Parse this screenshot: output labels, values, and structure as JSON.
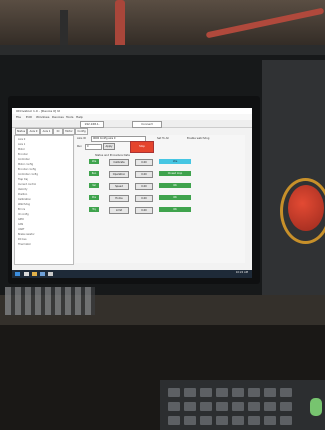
{
  "app": {
    "title": "ODrivetool 1.0 - [Device 0] UI"
  },
  "menu": [
    "File",
    "Edit",
    "Windows",
    "Devices",
    "Tools",
    "Help"
  ],
  "toolbar": {
    "address": "192.168.1.",
    "connect": "Connect"
  },
  "tabs": [
    "Status",
    "Axis 0",
    "Axis 1",
    "IO",
    "Motor",
    "Config"
  ],
  "tree": [
    "Axis 0",
    "Axis 1",
    "Motor",
    "Encoder",
    "Controller",
    "Motor config",
    "Encoder config",
    "Controller config",
    "Trap traj",
    "Current control",
    "Velocity",
    "Position",
    "Calibration",
    "Watchdog",
    "Errors",
    "IO config",
    "GPIO",
    "CAN",
    "UART",
    "Brake resistor",
    "DC bus",
    "Thermistor"
  ],
  "panel": {
    "top_label": "Axis ID",
    "top_field": "0000 Config axis 0",
    "checkbox1": "Set To All",
    "checkbox2": "Enable watchdog",
    "run_label": "Run",
    "run_field": "0",
    "run_btn": "Apply",
    "stop_btn": "Stop",
    "section": "Status and Procedure Data",
    "rows": [
      {
        "tag": "Idle",
        "button": "Calibrate",
        "status_text": "Idle"
      },
      {
        "tag": "Run",
        "button": "Operation",
        "status_text": "Closed loop"
      },
      {
        "tag": "Vel",
        "button": "Speed",
        "status_text": "OK"
      },
      {
        "tag": "Pos",
        "button": "Home",
        "status_text": "OK"
      },
      {
        "tag": "Trq",
        "button": "Limit",
        "status_text": "OK"
      }
    ],
    "row_values": [
      "0.00",
      "0.00",
      "0.00",
      "0.00",
      "0.00"
    ]
  },
  "clock": "10:24 AM"
}
